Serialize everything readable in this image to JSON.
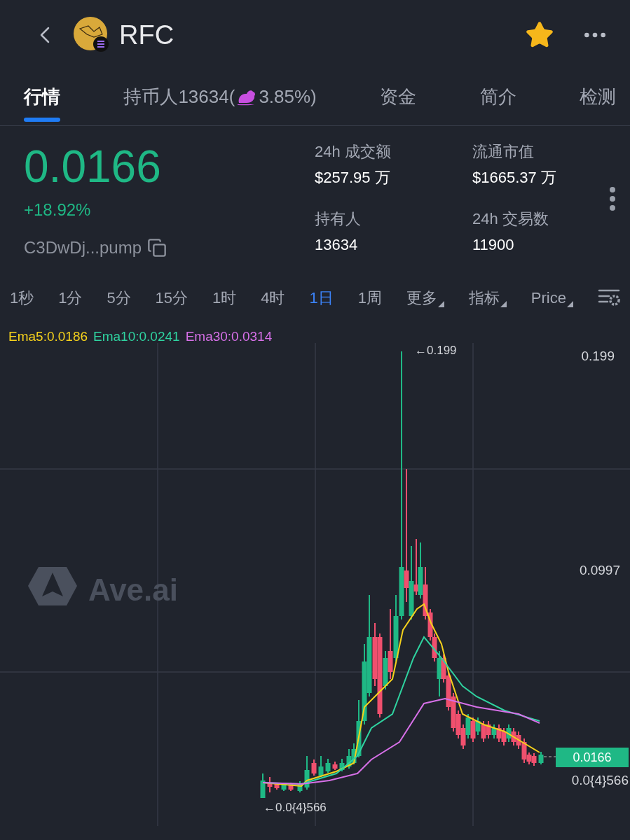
{
  "header": {
    "symbol": "RFC",
    "favorite": true
  },
  "tabs": [
    {
      "label": "行情",
      "selected": true
    },
    {
      "label": "持币人13634(",
      "suffix": "3.85%)",
      "selected": false
    },
    {
      "label": "资金",
      "selected": false
    },
    {
      "label": "简介",
      "selected": false
    },
    {
      "label": "检测",
      "selected": false
    }
  ],
  "price": {
    "value": "0.0166",
    "change": "+18.92%",
    "address": "C3DwDj...pump"
  },
  "stats": [
    {
      "label": "24h 成交额",
      "value": "$257.95 万"
    },
    {
      "label": "流通市值",
      "value": "$1665.37 万"
    },
    {
      "label": "持有人",
      "value": "13634"
    },
    {
      "label": "24h 交易数",
      "value": "11900"
    }
  ],
  "timeframes": [
    {
      "label": "1秒",
      "kind": "interval",
      "selected": false
    },
    {
      "label": "1分",
      "kind": "interval",
      "selected": false
    },
    {
      "label": "5分",
      "kind": "interval",
      "selected": false
    },
    {
      "label": "15分",
      "kind": "interval",
      "selected": false
    },
    {
      "label": "1时",
      "kind": "interval",
      "selected": false
    },
    {
      "label": "4时",
      "kind": "interval",
      "selected": false
    },
    {
      "label": "1日",
      "kind": "interval",
      "selected": true
    },
    {
      "label": "1周",
      "kind": "interval",
      "selected": false
    },
    {
      "label": "更多",
      "kind": "dropdown",
      "selected": false
    },
    {
      "label": "指标",
      "kind": "dropdown",
      "selected": false
    },
    {
      "label": "Price",
      "kind": "dropdown",
      "selected": false
    }
  ],
  "chart": {
    "legend": [
      {
        "label": "Ema5:0.0186",
        "color": "#f5d11c"
      },
      {
        "label": "Ema10:0.0241",
        "color": "#2fd3a0"
      },
      {
        "label": "Ema30:0.0314",
        "color": "#d770e8"
      }
    ],
    "watermark": "Ave.ai",
    "high_marker": "←0.199",
    "low_marker": "←0.0{4}566",
    "axis_labels": [
      "0.199",
      "0.0997"
    ],
    "current_price": "0.0166",
    "axis_low": "0.0{4}566"
  }
}
